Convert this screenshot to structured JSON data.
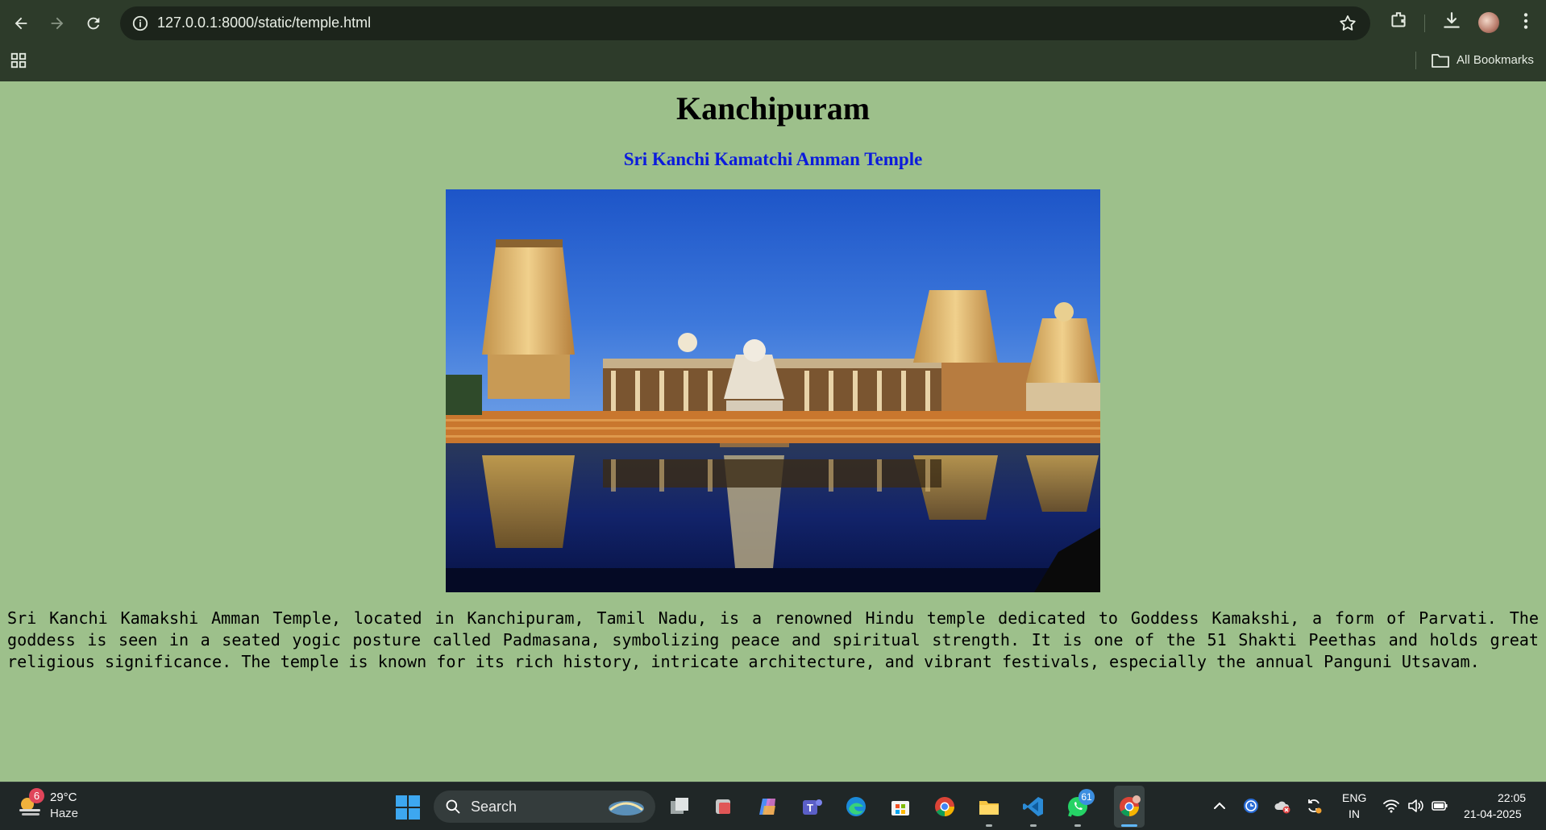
{
  "browser": {
    "url": "127.0.0.1:8000/static/temple.html",
    "bookmarks_label": "All Bookmarks",
    "icons": [
      "back-arrow-icon",
      "forward-arrow-icon",
      "reload-icon",
      "site-info-icon",
      "star-icon",
      "extensions-icon",
      "download-icon",
      "avatar",
      "more-menu-icon",
      "apps-grid-icon",
      "folder-icon"
    ]
  },
  "page": {
    "title": "Kanchipuram",
    "subtitle": "Sri Kanchi Kamatchi Amman Temple",
    "subtitle_color": "#0b1bdc",
    "background_color": "#9dc08b",
    "description": "Sri Kanchi Kamakshi Amman Temple, located in Kanchipuram, Tamil Nadu, is a renowned Hindu temple dedicated to Goddess Kamakshi, a form of Parvati. The goddess is seen in a seated yogic posture called Padmasana, symbolizing peace and spiritual strength. It is one of the 51 Shakti Peethas and holds great religious significance. The temple is known for its rich history, intricate architecture, and vibrant festivals, especially the annual Panguni Utsavam."
  },
  "taskbar": {
    "weather": {
      "badge": "6",
      "temp": "29°C",
      "condition": "Haze"
    },
    "search_label": "Search",
    "whatsapp_badge": "61",
    "language": {
      "line1": "ENG",
      "line2": "IN"
    },
    "clock": {
      "time": "22:05",
      "date": "21-04-2025"
    },
    "apps": [
      "file-explorer-icon",
      "copilot-icon",
      "teams-icon",
      "edge-icon",
      "store-icon",
      "chrome-icon",
      "folder-icon",
      "vscode-icon",
      "whatsapp-icon",
      "chrome-profile-icon"
    ]
  }
}
